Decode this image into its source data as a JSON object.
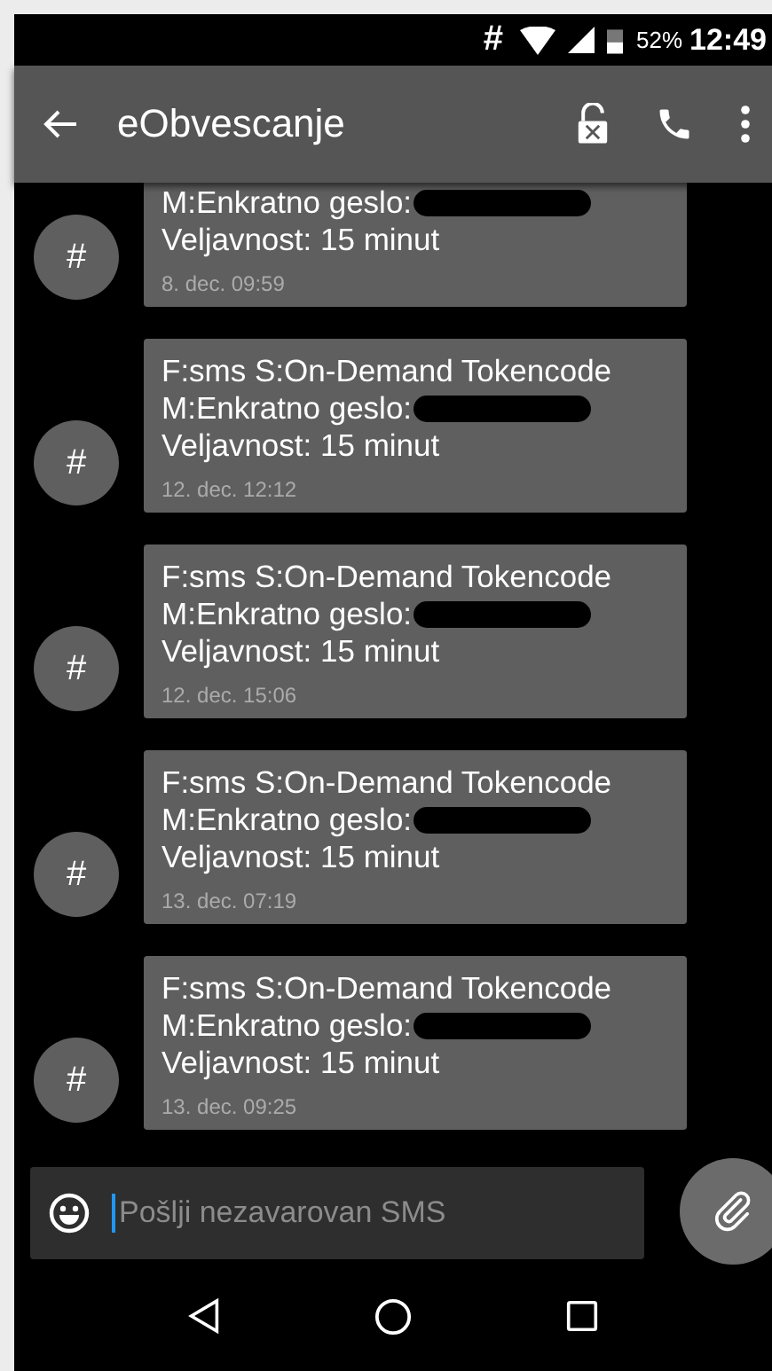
{
  "status_bar": {
    "notification": "#",
    "battery": "52%",
    "time": "12:49"
  },
  "toolbar": {
    "title": "eObvescanje"
  },
  "messages": [
    {
      "avatar": "#",
      "lines": [
        "M:Enkratno geslo:",
        "Veljavnost: 15 minut"
      ],
      "redacted": true,
      "time": "8. dec. 09:59"
    },
    {
      "avatar": "#",
      "lines": [
        "F:sms S:On-Demand Tokencode",
        "M:Enkratno geslo:",
        "Veljavnost: 15 minut"
      ],
      "redacted": true,
      "time": "12. dec. 12:12"
    },
    {
      "avatar": "#",
      "lines": [
        "F:sms S:On-Demand Tokencode",
        "M:Enkratno geslo:",
        "Veljavnost: 15 minut"
      ],
      "redacted": true,
      "time": "12. dec. 15:06"
    },
    {
      "avatar": "#",
      "lines": [
        "F:sms S:On-Demand Tokencode",
        "M:Enkratno geslo:",
        "Veljavnost: 15 minut"
      ],
      "redacted": true,
      "time": "13. dec. 07:19"
    },
    {
      "avatar": "#",
      "lines": [
        "F:sms S:On-Demand Tokencode",
        "M:Enkratno geslo:",
        "Veljavnost: 15 minut"
      ],
      "redacted": true,
      "time": "13. dec. 09:25"
    }
  ],
  "composer": {
    "placeholder": "Pošlji nezavarovan SMS"
  }
}
